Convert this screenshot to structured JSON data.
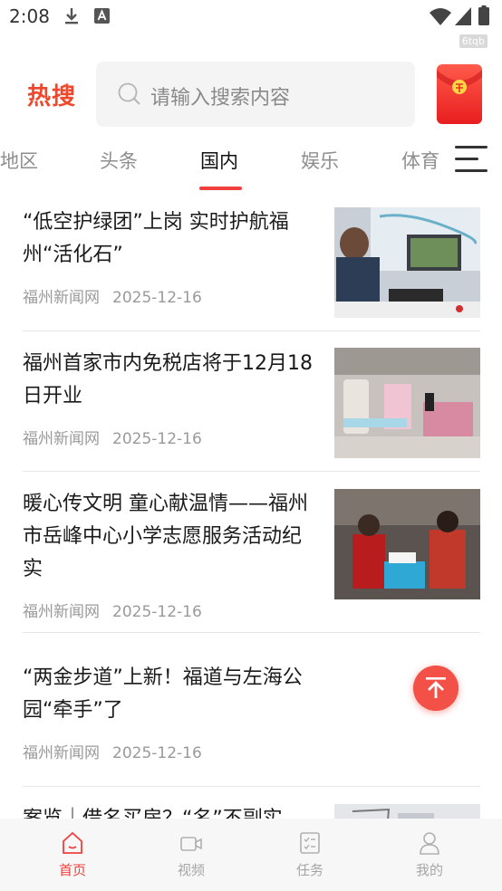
{
  "status_bar": {
    "time": "2:08",
    "icons": [
      "download-icon",
      "a-icon",
      "wifi-icon",
      "signal-icon",
      "battery-icon"
    ]
  },
  "watermark": "6tqb",
  "header": {
    "logo": "热搜",
    "search_placeholder": "请输入搜索内容",
    "accent_color": "#f0403e"
  },
  "tabs": [
    {
      "label": "地区"
    },
    {
      "label": "头条"
    },
    {
      "label": "国内",
      "active": true
    },
    {
      "label": "娱乐"
    },
    {
      "label": "体育"
    }
  ],
  "news": [
    {
      "title": "“低空护绿团”上岗 实时护航福州“活化石”",
      "source": "福州新闻网",
      "date": "2025-12-16",
      "has_image": true
    },
    {
      "title": "福州首家市内免税店将于12月18日开业",
      "source": "福州新闻网",
      "date": "2025-12-16",
      "has_image": true
    },
    {
      "title": "暖心传文明 童心献温情——福州市岳峰中心小学志愿服务活动纪实",
      "source": "福州新闻网",
      "date": "2025-12-16",
      "has_image": true
    },
    {
      "title": "“两金步道”上新！福道与左海公园“牵手”了",
      "source": "福州新闻网",
      "date": "2025-12-16",
      "has_image": false
    },
    {
      "title": "案览｜借名买房？“名”不副实",
      "source": "",
      "date": "",
      "has_image": true
    }
  ],
  "bottom_nav": [
    {
      "label": "首页",
      "icon": "home-icon",
      "active": true
    },
    {
      "label": "视频",
      "icon": "video-icon"
    },
    {
      "label": "任务",
      "icon": "task-icon"
    },
    {
      "label": "我的",
      "icon": "profile-icon"
    }
  ]
}
